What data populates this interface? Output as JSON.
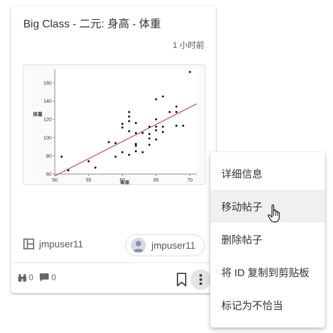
{
  "card": {
    "title": "Big Class - 二元: 身高 - 体重",
    "time": "1 小时前",
    "group_label": "jmpuser11",
    "author": "jmpuser11",
    "views": "0",
    "comments": "0"
  },
  "chart_data": {
    "type": "scatter",
    "xlabel": "身高",
    "ylabel": "体重",
    "xlim": [
      50,
      71
    ],
    "ylim": [
      60,
      175
    ],
    "x_ticks": [
      "50",
      "55",
      "60",
      "65",
      "70"
    ],
    "y_ticks": [
      "60",
      "80",
      "100",
      "120",
      "140",
      "160"
    ],
    "fit_line": {
      "x": [
        50,
        71
      ],
      "y": [
        58,
        137
      ]
    },
    "line_color": "#d0455c",
    "points": [
      [
        51,
        79
      ],
      [
        52,
        64
      ],
      [
        55,
        74
      ],
      [
        56,
        67
      ],
      [
        58,
        95
      ],
      [
        59,
        79
      ],
      [
        59,
        94
      ],
      [
        60,
        84
      ],
      [
        60,
        111
      ],
      [
        60,
        115
      ],
      [
        61,
        81
      ],
      [
        61,
        107
      ],
      [
        61,
        118
      ],
      [
        61,
        123
      ],
      [
        61,
        128
      ],
      [
        62,
        85
      ],
      [
        62,
        91
      ],
      [
        62,
        93
      ],
      [
        62,
        105
      ],
      [
        62,
        116
      ],
      [
        63,
        84
      ],
      [
        63,
        105
      ],
      [
        64,
        92
      ],
      [
        64,
        99
      ],
      [
        64,
        104
      ],
      [
        64,
        112
      ],
      [
        65,
        98
      ],
      [
        65,
        108
      ],
      [
        65,
        112
      ],
      [
        65,
        120
      ],
      [
        65,
        142
      ],
      [
        66,
        106
      ],
      [
        66,
        112
      ],
      [
        66,
        145
      ],
      [
        67,
        128
      ],
      [
        68,
        113
      ],
      [
        68,
        128
      ],
      [
        68,
        134
      ],
      [
        69,
        113
      ],
      [
        70,
        172
      ]
    ]
  },
  "menu": {
    "items": [
      "详细信息",
      "移动帖子",
      "删除帖子",
      "将 ID 复制到剪贴板",
      "标记为不恰当"
    ],
    "hovered_index": 1
  }
}
